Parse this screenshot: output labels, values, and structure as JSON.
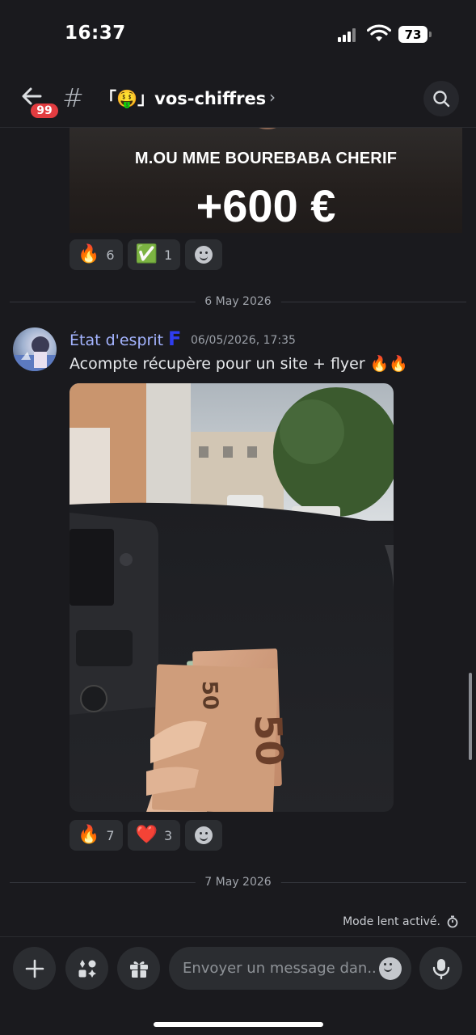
{
  "status": {
    "time": "16:37",
    "battery": "73"
  },
  "header": {
    "unread_badge": "99",
    "channel_name": "「🤑」vos-chiffres"
  },
  "promo": {
    "name": "M.OU MME BOUREBABA CHERIF",
    "amount": "+600 €"
  },
  "reactions_top": [
    {
      "emoji": "🔥",
      "count": "6"
    },
    {
      "emoji": "✅",
      "count": "1"
    }
  ],
  "dividers": {
    "first": "6 May 2026",
    "second": "7 May 2026"
  },
  "message": {
    "author": "État d'esprit",
    "tag": "F",
    "timestamp": "06/05/2026, 17:35",
    "text": "Acompte récupère pour un site + flyer 🔥🔥"
  },
  "reactions_msg": [
    {
      "emoji": "🔥",
      "count": "7"
    },
    {
      "emoji": "❤️",
      "count": "3"
    }
  ],
  "composer": {
    "slow_mode": "Mode lent activé.",
    "placeholder": "Envoyer un message dan.."
  }
}
